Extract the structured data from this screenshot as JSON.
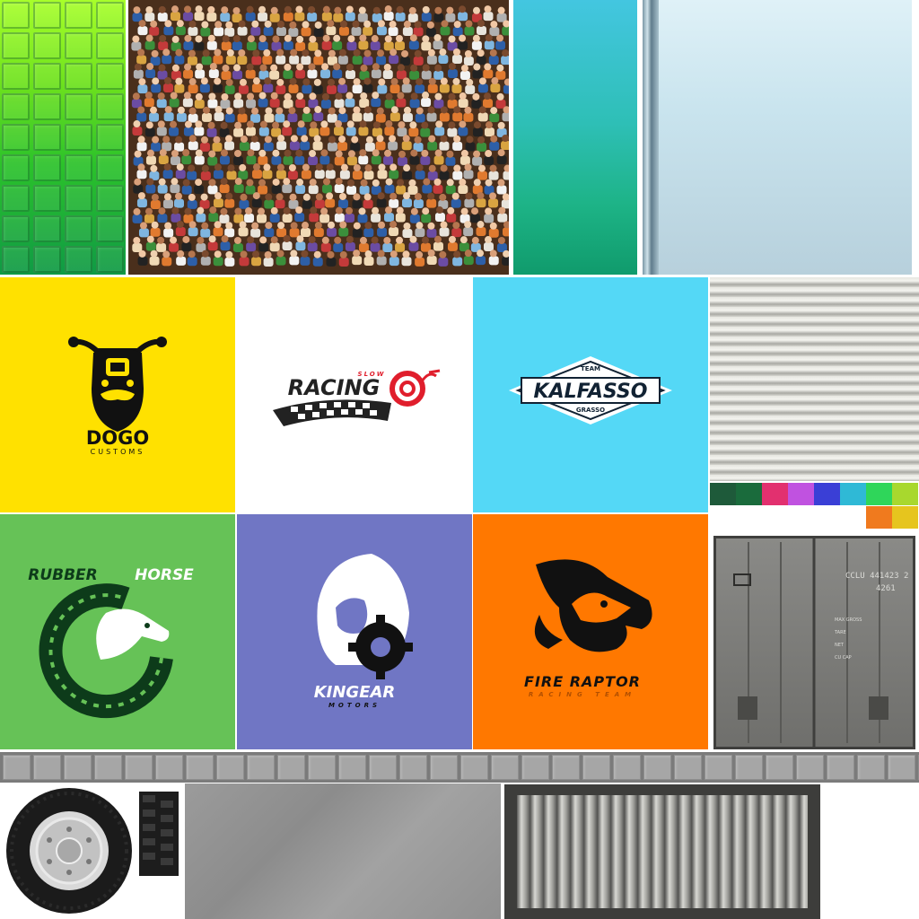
{
  "atlas": {
    "top_row": {
      "green_grid": {
        "icon": "green-tile-grid",
        "columns": 4,
        "rows": 9
      },
      "crowd": {
        "icon": "spectator-crowd-photo"
      },
      "teal_gradient": {
        "icon": "teal-green-gradient"
      },
      "glass_panel": {
        "icon": "glass-panel-with-pole"
      }
    },
    "logos": [
      {
        "id": "dogo",
        "line1": "DOGO",
        "line2": "CUSTOMS",
        "bg": "#ffe100",
        "icon": "bearded-biker-icon"
      },
      {
        "id": "racing",
        "line1": "RACING",
        "line2": "SLOW",
        "bg": "#ffffff",
        "icon": "snail-checkered-flag-icon"
      },
      {
        "id": "kalfasso",
        "line1": "KALFASSO",
        "top": "TEAM",
        "bottom": "GRASSO",
        "bg": "#54d8f6",
        "icon": "diamond-badge-icon"
      },
      {
        "id": "rubber",
        "line1a": "RUBBER",
        "line1b": "HORSE",
        "bg": "#66c257",
        "icon": "horse-tire-icon"
      },
      {
        "id": "kingear",
        "line1": "KINGEAR",
        "line2": "MOTORS",
        "bg": "#7076c4",
        "icon": "lion-gear-icon"
      },
      {
        "id": "raptor",
        "line1": "FIRE RAPTOR",
        "line2": "RACING TEAM",
        "bg": "#ff7800",
        "icon": "raptor-head-icon"
      }
    ],
    "swatches": [
      "#1e5a3a",
      "#1a6b3c",
      "#e2306f",
      "#c052e0",
      "#3a3fd6",
      "#2fb9d6",
      "#2fd65a",
      "#a8d82e",
      "#f07a1e",
      "#e6c51e"
    ],
    "container_door": {
      "icon": "shipping-container-door",
      "code": "CCLU 441423 2",
      "type": "4261",
      "labels": [
        "MAX GROSS",
        "TARE",
        "NET",
        "CU CAP"
      ]
    },
    "strip": {
      "icon": "grey-brick-strip",
      "count": 32
    },
    "bottom": {
      "tire": {
        "icon": "wheel-tire-icon"
      },
      "tread": {
        "icon": "tire-tread-icon"
      },
      "concrete": {
        "icon": "concrete-texture"
      },
      "container_side": {
        "icon": "container-side-ribs"
      }
    }
  }
}
